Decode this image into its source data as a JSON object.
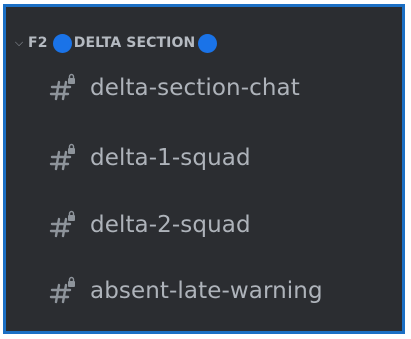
{
  "category": {
    "code": "F2",
    "name": "DELTA SECTION",
    "icon": "chevron-down-icon",
    "circle_color": "#1a73e8"
  },
  "channels": [
    {
      "label": "delta-section-chat",
      "icon": "locked-hash-icon"
    },
    {
      "label": "delta-1-squad",
      "icon": "locked-hash-icon"
    },
    {
      "label": "delta-2-squad",
      "icon": "locked-hash-icon"
    },
    {
      "label": "absent-late-warning",
      "icon": "locked-hash-icon"
    }
  ],
  "colors": {
    "background": "#2b2d31",
    "border": "#1b6fc4",
    "text": "#aeb3ba"
  }
}
